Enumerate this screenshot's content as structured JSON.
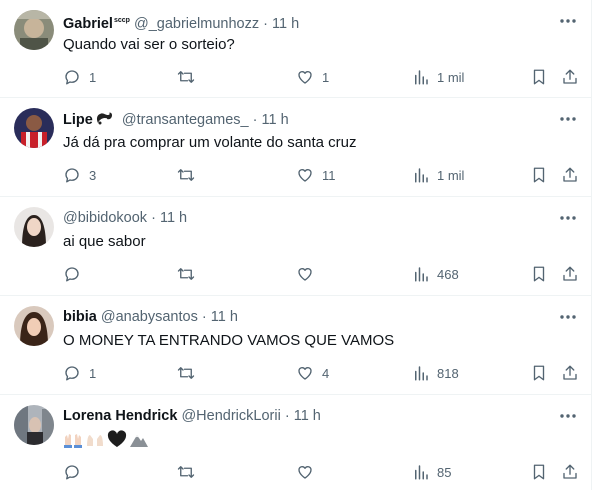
{
  "tweets": [
    {
      "name": "Gabriel",
      "badge": "sccp",
      "handle": "@_gabrielmunhozz",
      "dot": "·",
      "time": "11 h",
      "text": "Quando vai ser o sorteio?",
      "replies": "1",
      "retweets": "",
      "likes": "1",
      "views": "1 mil"
    },
    {
      "name": "Lipe",
      "handle": "@transantegames_",
      "dot": "·",
      "time": "11 h",
      "text": "Já dá pra comprar um volante do santa cruz",
      "replies": "3",
      "retweets": "",
      "likes": "11",
      "views": "1 mil"
    },
    {
      "name": "",
      "handle": "@bibidokook",
      "dot": "·",
      "time": "11 h",
      "text": "ai que sabor",
      "replies": "",
      "retweets": "",
      "likes": "",
      "views": "468"
    },
    {
      "name": "bibia",
      "handle": "@anabysantos",
      "dot": "·",
      "time": "11 h",
      "text": "O MONEY TA ENTRANDO VAMOS QUE VAMOS",
      "replies": "1",
      "retweets": "",
      "likes": "4",
      "views": "818"
    },
    {
      "name": "Lorena Hendrick",
      "handle": "@HendrickLorii",
      "dot": "·",
      "time": "11 h",
      "text": "",
      "replies": "",
      "retweets": "",
      "likes": "",
      "views": "85"
    }
  ],
  "icons": {
    "more": "more-icon",
    "reply": "reply-icon",
    "retweet": "retweet-icon",
    "like": "heart-icon",
    "views": "views-icon",
    "bookmark": "bookmark-icon",
    "share": "share-icon"
  },
  "colors": {
    "text": "#0f1419",
    "secondary": "#536471",
    "divider": "#eff3f4"
  }
}
